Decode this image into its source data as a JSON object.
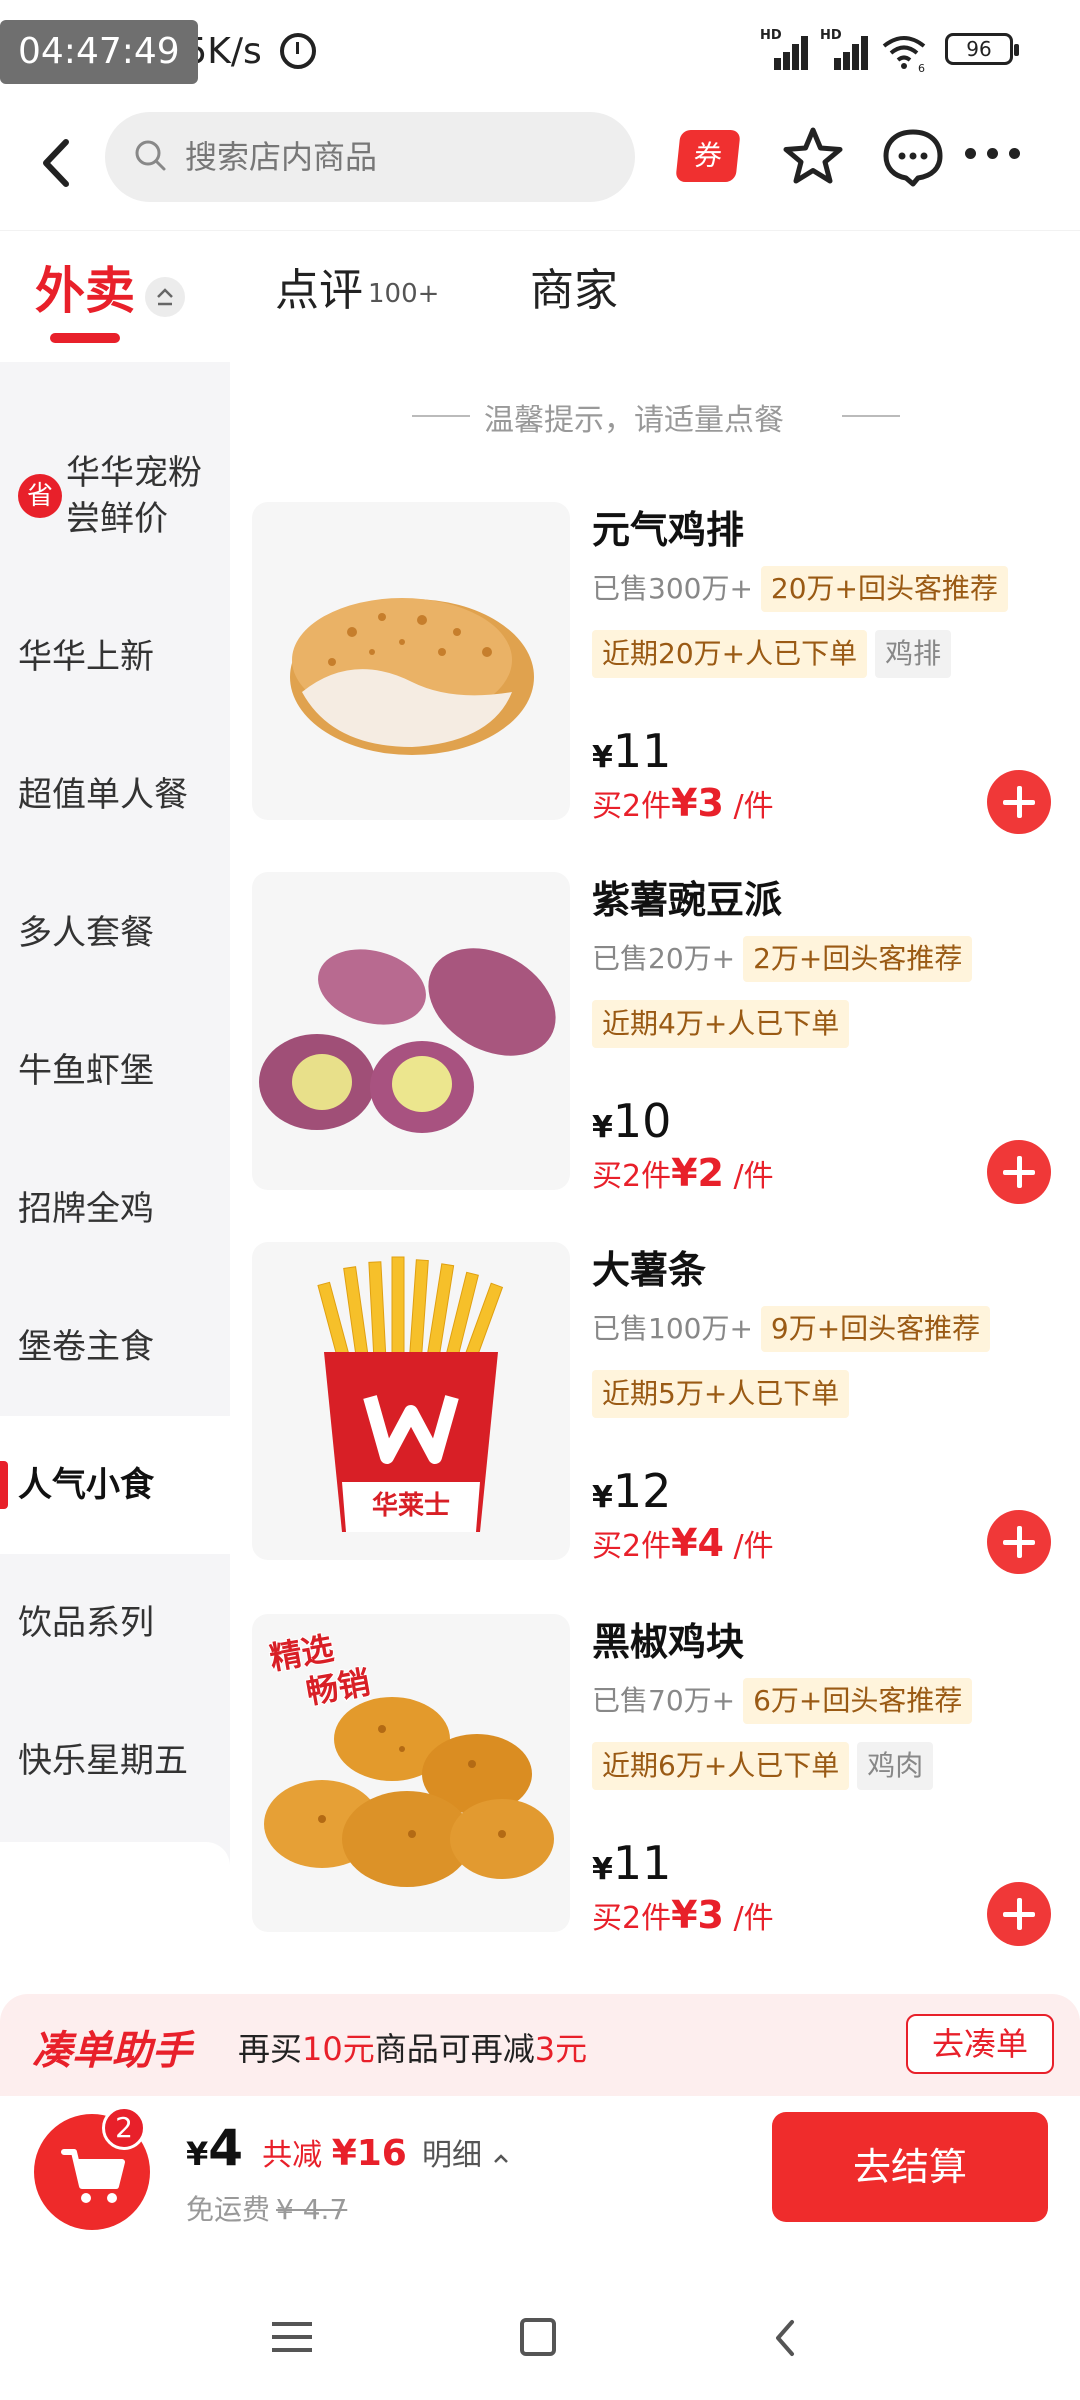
{
  "status_bar": {
    "time": "04:47:49",
    "net_speed": "2.5K/s",
    "signal1_label": "HD",
    "signal2_label": "HD",
    "wifi_label": "6",
    "battery": "96"
  },
  "header": {
    "search_placeholder": "搜索店内商品",
    "coupon_label": "券"
  },
  "tabs": [
    {
      "label": "外卖",
      "active": true
    },
    {
      "label": "点评",
      "badge": "100+"
    },
    {
      "label": "商家"
    }
  ],
  "sidebar": {
    "categories": [
      {
        "label": "华华宠粉尝鲜价",
        "badge": "省"
      },
      {
        "label": "华华上新"
      },
      {
        "label": "超值单人餐"
      },
      {
        "label": "多人套餐"
      },
      {
        "label": "牛鱼虾堡"
      },
      {
        "label": "招牌全鸡"
      },
      {
        "label": "堡卷主食"
      },
      {
        "label": "人气小食",
        "active": true
      },
      {
        "label": "饮品系列"
      },
      {
        "label": "快乐星期五"
      }
    ]
  },
  "tip": "温馨提示，请适量点餐",
  "products": [
    {
      "name": "元气鸡排",
      "sold": "已售300万+",
      "recommend": "20万+回头客推荐",
      "recent": "近期20万+人已下单",
      "category_tag": "鸡排",
      "currency": "¥",
      "price": "11",
      "deal_prefix": "买2件",
      "deal_price": "¥3",
      "deal_unit": "/件"
    },
    {
      "name": "紫薯豌豆派",
      "sold": "已售20万+",
      "recommend": "2万+回头客推荐",
      "recent": "近期4万+人已下单",
      "category_tag": "",
      "currency": "¥",
      "price": "10",
      "deal_prefix": "买2件",
      "deal_price": "¥2",
      "deal_unit": "/件"
    },
    {
      "name": "大薯条",
      "sold": "已售100万+",
      "recommend": "9万+回头客推荐",
      "recent": "近期5万+人已下单",
      "category_tag": "",
      "currency": "¥",
      "price": "12",
      "deal_prefix": "买2件",
      "deal_price": "¥4",
      "deal_unit": "/件",
      "image_text": "华莱士"
    },
    {
      "name": "黑椒鸡块",
      "sold": "已售70万+",
      "recommend": "6万+回头客推荐",
      "recent": "近期6万+人已下单",
      "category_tag": "鸡肉",
      "currency": "¥",
      "price": "11",
      "deal_prefix": "买2件",
      "deal_price": "¥3",
      "deal_unit": "/件",
      "image_badge_line1": "精选",
      "image_badge_line2": "畅销"
    }
  ],
  "assistant": {
    "title": "凑单助手",
    "text_1": "再买",
    "amount": "10元",
    "text_2": "商品可再减",
    "discount": "3元",
    "button": "去凑单"
  },
  "cart": {
    "count": "2",
    "currency": "¥",
    "total": "4",
    "saved_label": "共减",
    "saved_amount": "¥16",
    "detail_label": "明细",
    "delivery_label": "免运费",
    "delivery_original": "¥ 4.7",
    "checkout": "去结算"
  },
  "colors": {
    "brand_red": "#e8202a",
    "tag_bg": "#fff4dc",
    "tag_text": "#9a5a14"
  }
}
